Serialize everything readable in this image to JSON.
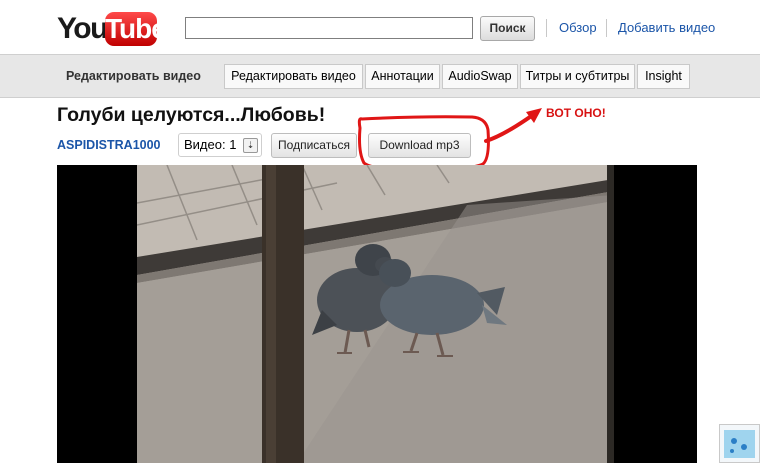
{
  "header": {
    "logo_you": "You",
    "logo_tube": "Tube",
    "search": {
      "value": "",
      "button": "Поиск"
    },
    "links": [
      "Обзор",
      "Добавить видео"
    ]
  },
  "edit_bar": {
    "label": "Редактировать видео",
    "tabs": [
      "Редактировать видео",
      "Аннотации",
      "AudioSwap",
      "Титры и субтитры",
      "Insight"
    ]
  },
  "video": {
    "title": "Голуби целуются...Любовь!",
    "channel": "ASPIDISTRA1000",
    "count_label": "Видео: 1",
    "subscribe": "Подписаться",
    "download": "Download mp3"
  },
  "annotation": {
    "text": "ВОТ ОНО!",
    "color": "#d81212"
  },
  "colors": {
    "link": "#1b55a8",
    "logo_red": "#cc0000",
    "edit_bar_bg": "#e7e7e7"
  },
  "icons": {
    "dropdown": "chevron-down-icon",
    "arrow": "red-arrow-icon",
    "highlight": "red-ellipse-icon"
  }
}
